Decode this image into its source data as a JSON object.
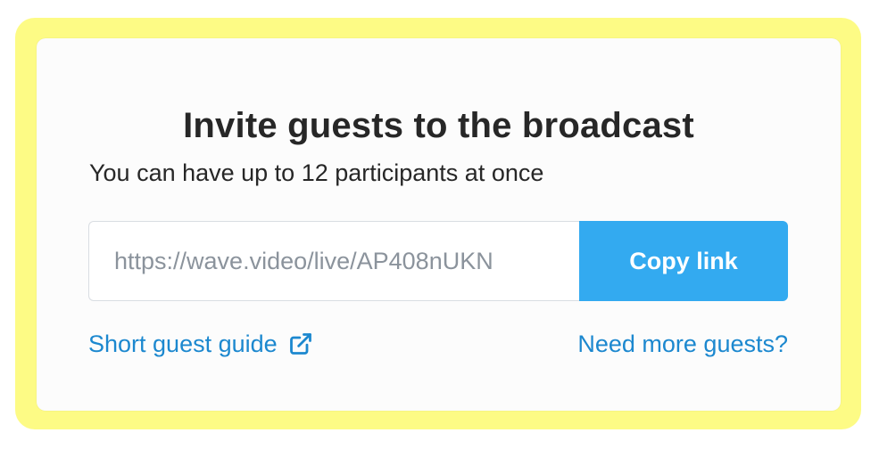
{
  "dialog": {
    "title": "Invite guests to the broadcast",
    "subtitle": "You can have up to 12 participants at once",
    "link_value": "https://wave.video/live/AP408nUKN",
    "copy_button_label": "Copy link",
    "guide_link_label": "Short guest guide",
    "guide_link_icon": "external-link-icon",
    "more_guests_label": "Need more guests?"
  },
  "colors": {
    "highlight": "#fdfb85",
    "accent": "#33aaf0",
    "link": "#1c88cf",
    "text": "#272727"
  }
}
